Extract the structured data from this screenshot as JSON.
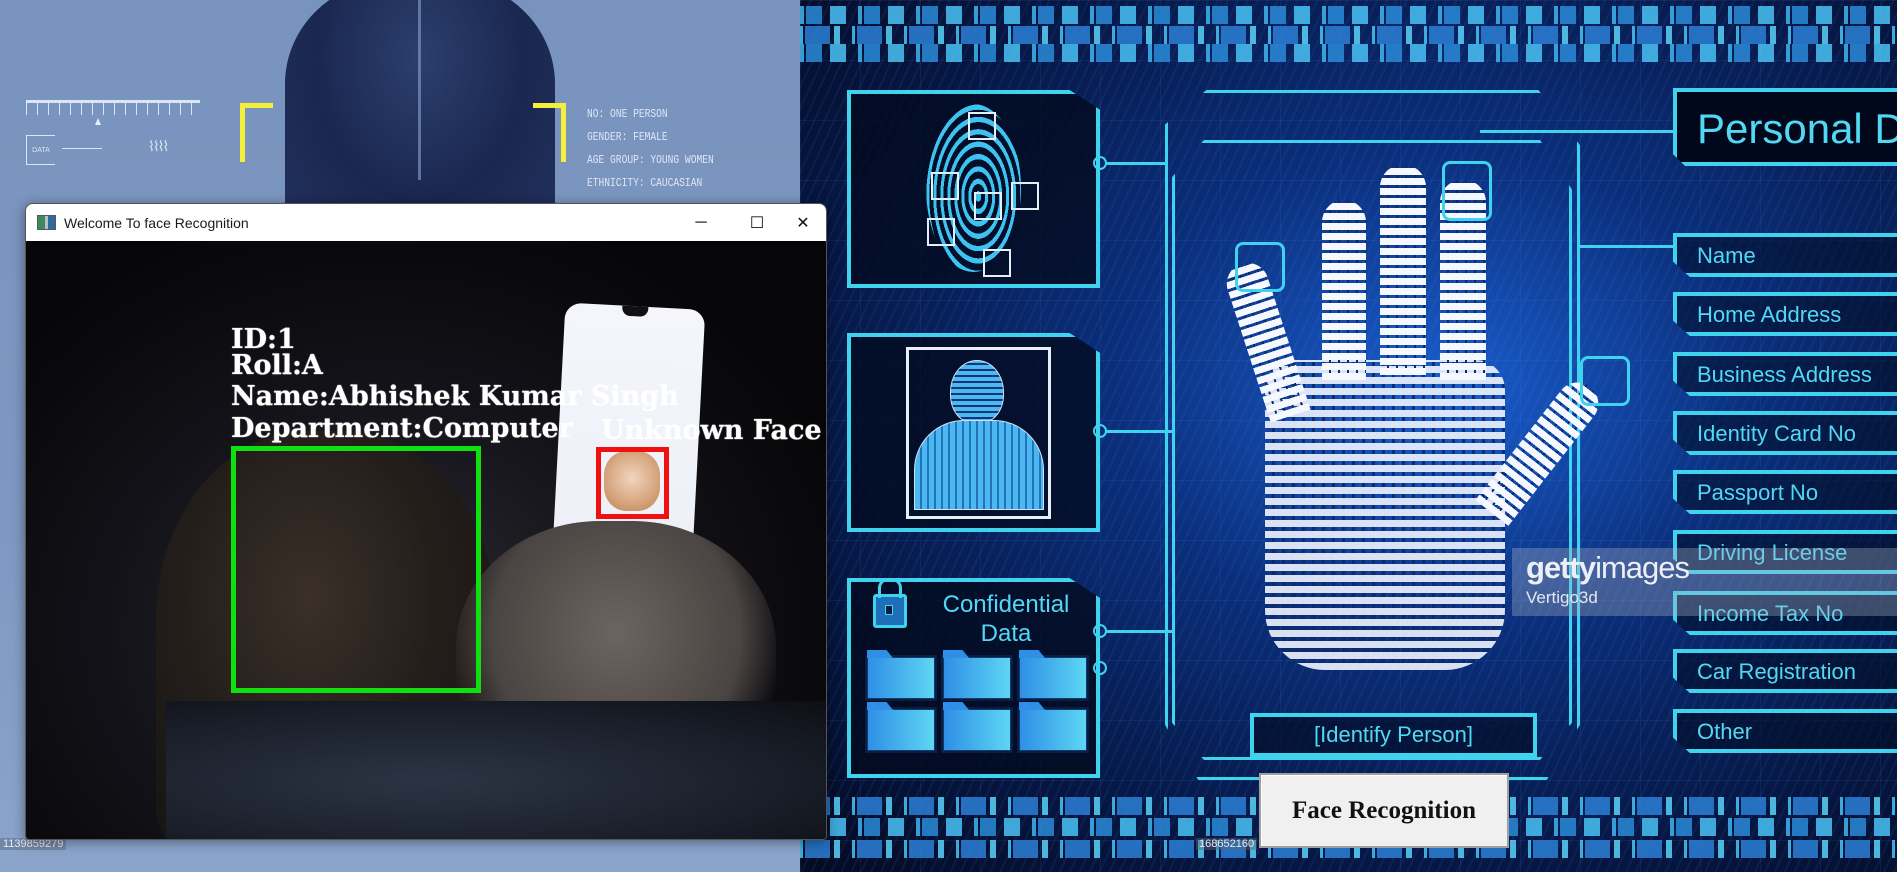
{
  "background_left": {
    "hud_lines": [
      "NO: ONE PERSON",
      "GENDER: FEMALE",
      "AGE GROUP: YOUNG WOMEN",
      "ETHNICITY: CAUCASIAN"
    ],
    "data_label": "DATA",
    "stock_id": "1139859279"
  },
  "background_right": {
    "stock_id": "168652160",
    "confidential_title_line1": "Confidential",
    "confidential_title_line2": "Data",
    "identify_label": "[Identify Person]",
    "personal_title": "Personal D",
    "personal_items": [
      "Name",
      "Home Address",
      "Business Address",
      "Identity Card No",
      "Passport No",
      "Driving License",
      "Income Tax No",
      "Car Registration",
      "Other"
    ],
    "watermark_brand_bold": "getty",
    "watermark_brand_light": "images",
    "watermark_credit": "Vertigo3d"
  },
  "launcher": {
    "face_recognition_button": "Face Recognition"
  },
  "window": {
    "title": "Welcome To face Recognition",
    "minimize_glyph": "─",
    "maximize_glyph": "☐",
    "close_glyph": "✕",
    "recognized": {
      "id_line": "ID:1",
      "roll_line": "Roll:A",
      "name_line": "Name:Abhishek Kumar Singh",
      "department_line": "Department:Computer",
      "box_color": "#10e010"
    },
    "unknown": {
      "label": "Unknown Face",
      "box_color": "#f01010"
    }
  }
}
